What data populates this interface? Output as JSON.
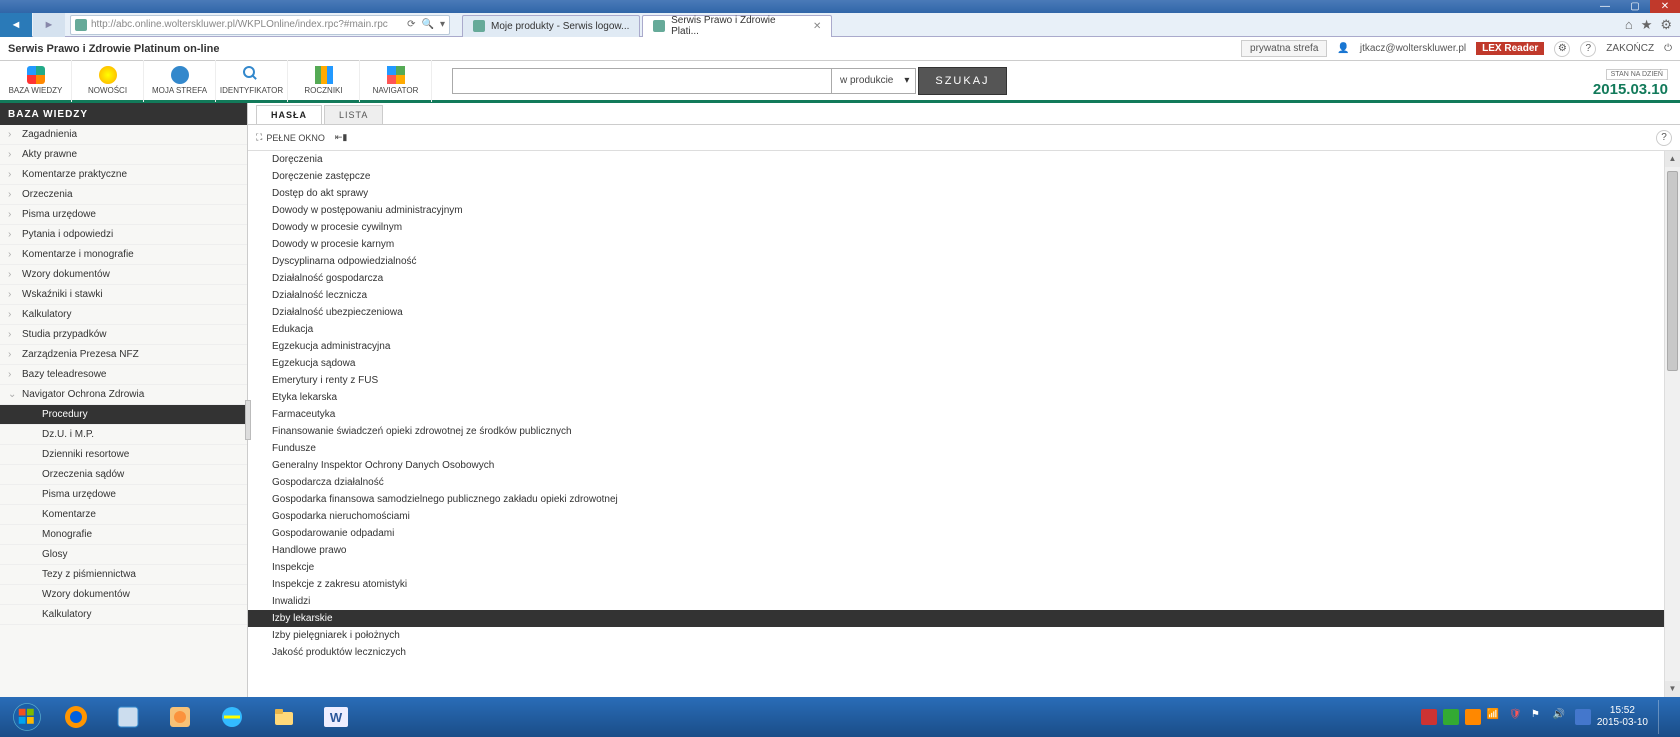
{
  "browser": {
    "url": "http://abc.online.wolterskluwer.pl/WKPLOnline/index.rpc?#main.rpc",
    "tabs": [
      {
        "label": "Moje produkty - Serwis logow...",
        "active": false
      },
      {
        "label": "Serwis Prawo i Zdrowie Plati...",
        "active": true
      }
    ]
  },
  "app": {
    "title": "Serwis Prawo i Zdrowie Platinum on-line",
    "private": "prywatna strefa",
    "user": "jtkacz@wolterskluwer.pl",
    "lex": "LEX Reader",
    "end": "ZAKOŃCZ"
  },
  "toolbar": {
    "items": [
      {
        "label": "BAZA WIEDZY"
      },
      {
        "label": "NOWOŚCI"
      },
      {
        "label": "MOJA STREFA"
      },
      {
        "label": "IDENTYFIKATOR"
      },
      {
        "label": "ROCZNIKI"
      },
      {
        "label": "NAVIGATOR"
      }
    ],
    "scope": "w produkcie",
    "search_btn": "SZUKAJ",
    "date_lbl": "STAN NA DZIEŃ",
    "date": "2015.03.10"
  },
  "sidebar": {
    "header": "BAZA WIEDZY",
    "items": [
      "Zagadnienia",
      "Akty prawne",
      "Komentarze praktyczne",
      "Orzeczenia",
      "Pisma urzędowe",
      "Pytania i odpowiedzi",
      "Komentarze i monografie",
      "Wzory dokumentów",
      "Wskaźniki i stawki",
      "Kalkulatory",
      "Studia przypadków",
      "Zarządzenia Prezesa NFZ",
      "Bazy teleadresowe",
      "Navigator Ochrona Zdrowia"
    ],
    "sub": [
      "Procedury",
      "Dz.U. i M.P.",
      "Dzienniki resortowe",
      "Orzeczenia sądów",
      "Pisma urzędowe",
      "Komentarze",
      "Monografie",
      "Glosy",
      "Tezy z piśmiennictwa",
      "Wzory dokumentów",
      "Kalkulatory"
    ]
  },
  "content": {
    "tabs": {
      "t1": "HASŁA",
      "t2": "LISTA"
    },
    "fullwindow": "PEŁNE OKNO",
    "list": [
      "Doręczenia",
      "Doręczenie zastępcze",
      "Dostęp do akt sprawy",
      "Dowody w postępowaniu administracyjnym",
      "Dowody w procesie cywilnym",
      "Dowody w procesie karnym",
      "Dyscyplinarna odpowiedzialność",
      "Działalność gospodarcza",
      "Działalność lecznicza",
      "Działalność ubezpieczeniowa",
      "Edukacja",
      "Egzekucja administracyjna",
      "Egzekucja sądowa",
      "Emerytury i renty z FUS",
      "Etyka lekarska",
      "Farmaceutyka",
      "Finansowanie świadczeń opieki zdrowotnej ze środków publicznych",
      "Fundusze",
      "Generalny Inspektor Ochrony Danych Osobowych",
      "Gospodarcza działalność",
      "Gospodarka finansowa samodzielnego publicznego zakładu opieki zdrowotnej",
      "Gospodarka nieruchomościami",
      "Gospodarowanie odpadami",
      "Handlowe prawo",
      "Inspekcje",
      "Inspekcje z zakresu atomistyki",
      "Inwalidzi",
      "Izby lekarskie",
      "Izby pielęgniarek i położnych",
      "Jakość produktów leczniczych"
    ],
    "selected": 27
  },
  "taskbar": {
    "time": "15:52",
    "date": "2015-03-10"
  }
}
